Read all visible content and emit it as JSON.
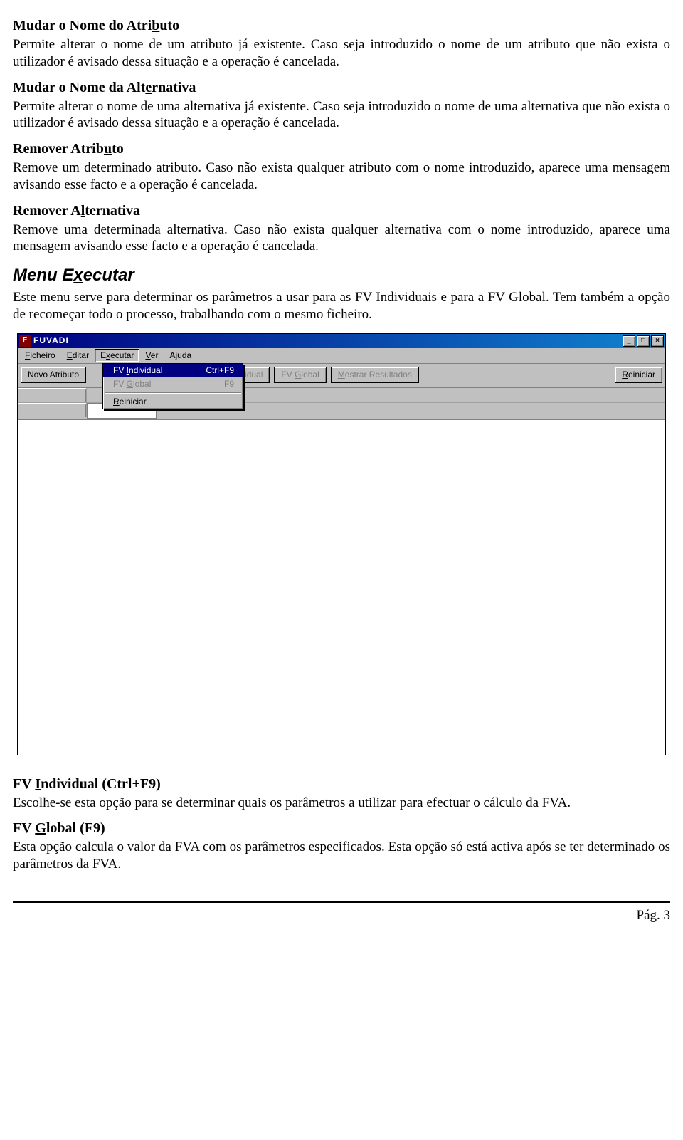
{
  "sections": {
    "s1": {
      "title": "Mudar o Nome do Atributo",
      "body": "Permite alterar o nome de um atributo já existente. Caso seja introduzido o nome de um atributo que não exista o utilizador é avisado dessa situação e a operação é cancelada."
    },
    "s2": {
      "title": "Mudar o Nome da Alternativa",
      "body": "Permite alterar o nome de uma alternativa já existente. Caso seja introduzido o nome de uma alternativa que não exista o utilizador é avisado dessa situação e a operação é cancelada."
    },
    "s3": {
      "title": "Remover Atributo",
      "body": "Remove um determinado atributo. Caso não exista qualquer atributo com o nome introduzido, aparece uma mensagem avisando esse facto e a operação é cancelada."
    },
    "s4": {
      "title": "Remover Alternativa",
      "body": "Remove uma determinada alternativa. Caso não exista qualquer alternativa com o nome introduzido, aparece uma mensagem avisando esse facto e a operação é cancelada."
    },
    "menu": {
      "title": "Menu Executar",
      "body": "Este menu serve para determinar os parâmetros a usar para as FV Individuais e para a FV Global. Tem também a opção de recomeçar todo o processo, trabalhando com o mesmo ficheiro."
    },
    "s5": {
      "title": "FV Individual (Ctrl+F9)",
      "body": "Escolhe-se esta opção para se determinar quais os parâmetros a utilizar para efectuar o cálculo da FVA."
    },
    "s6": {
      "title": "FV Global (F9)",
      "body": "Esta opção calcula o valor da FVA com os parâmetros especificados. Esta opção só está activa após se ter determinado os parâmetros da FVA."
    }
  },
  "window": {
    "title": "FUVADI",
    "menubar": {
      "ficheiro": "Ficheiro",
      "editar": "Editar",
      "executar": "Executar",
      "ver": "Ver",
      "ajuda": "Ajuda"
    },
    "dropdown": {
      "item1_label": "FV Individual",
      "item1_accel": "Ctrl+F9",
      "item2_label": "FV Global",
      "item2_accel": "F9",
      "item3_label": "Reiniciar"
    },
    "toolbar": {
      "novo_atributo": "Novo Atributo",
      "individual": "vidual",
      "fv_global": "FV Global",
      "mostrar": "Mostrar Resultados",
      "reiniciar": "Reiniciar"
    }
  },
  "footer": {
    "page": "Pág. 3"
  }
}
